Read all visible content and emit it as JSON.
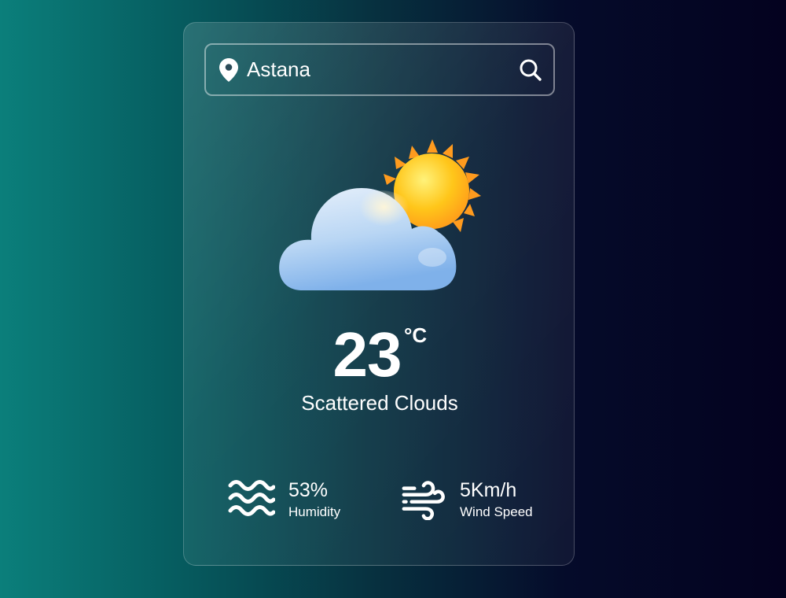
{
  "search": {
    "city_value": "Astana",
    "placeholder": "",
    "icons": {
      "location": "map-pin-icon",
      "search": "search-icon"
    }
  },
  "weather": {
    "icon": "sun-behind-cloud-icon",
    "temperature": "23",
    "unit": "°C",
    "description": "Scattered Clouds"
  },
  "stats": {
    "humidity": {
      "icon": "water-waves-icon",
      "value": "53%",
      "label": "Humidity"
    },
    "wind": {
      "icon": "wind-icon",
      "value": "5Km/h",
      "label": "Wind Speed"
    }
  },
  "colors": {
    "background_left": "#0b7f7b",
    "background_right": "#04021f",
    "text": "#ffffff",
    "sun": "#ffc61a",
    "cloud": "#a9cdf2"
  }
}
